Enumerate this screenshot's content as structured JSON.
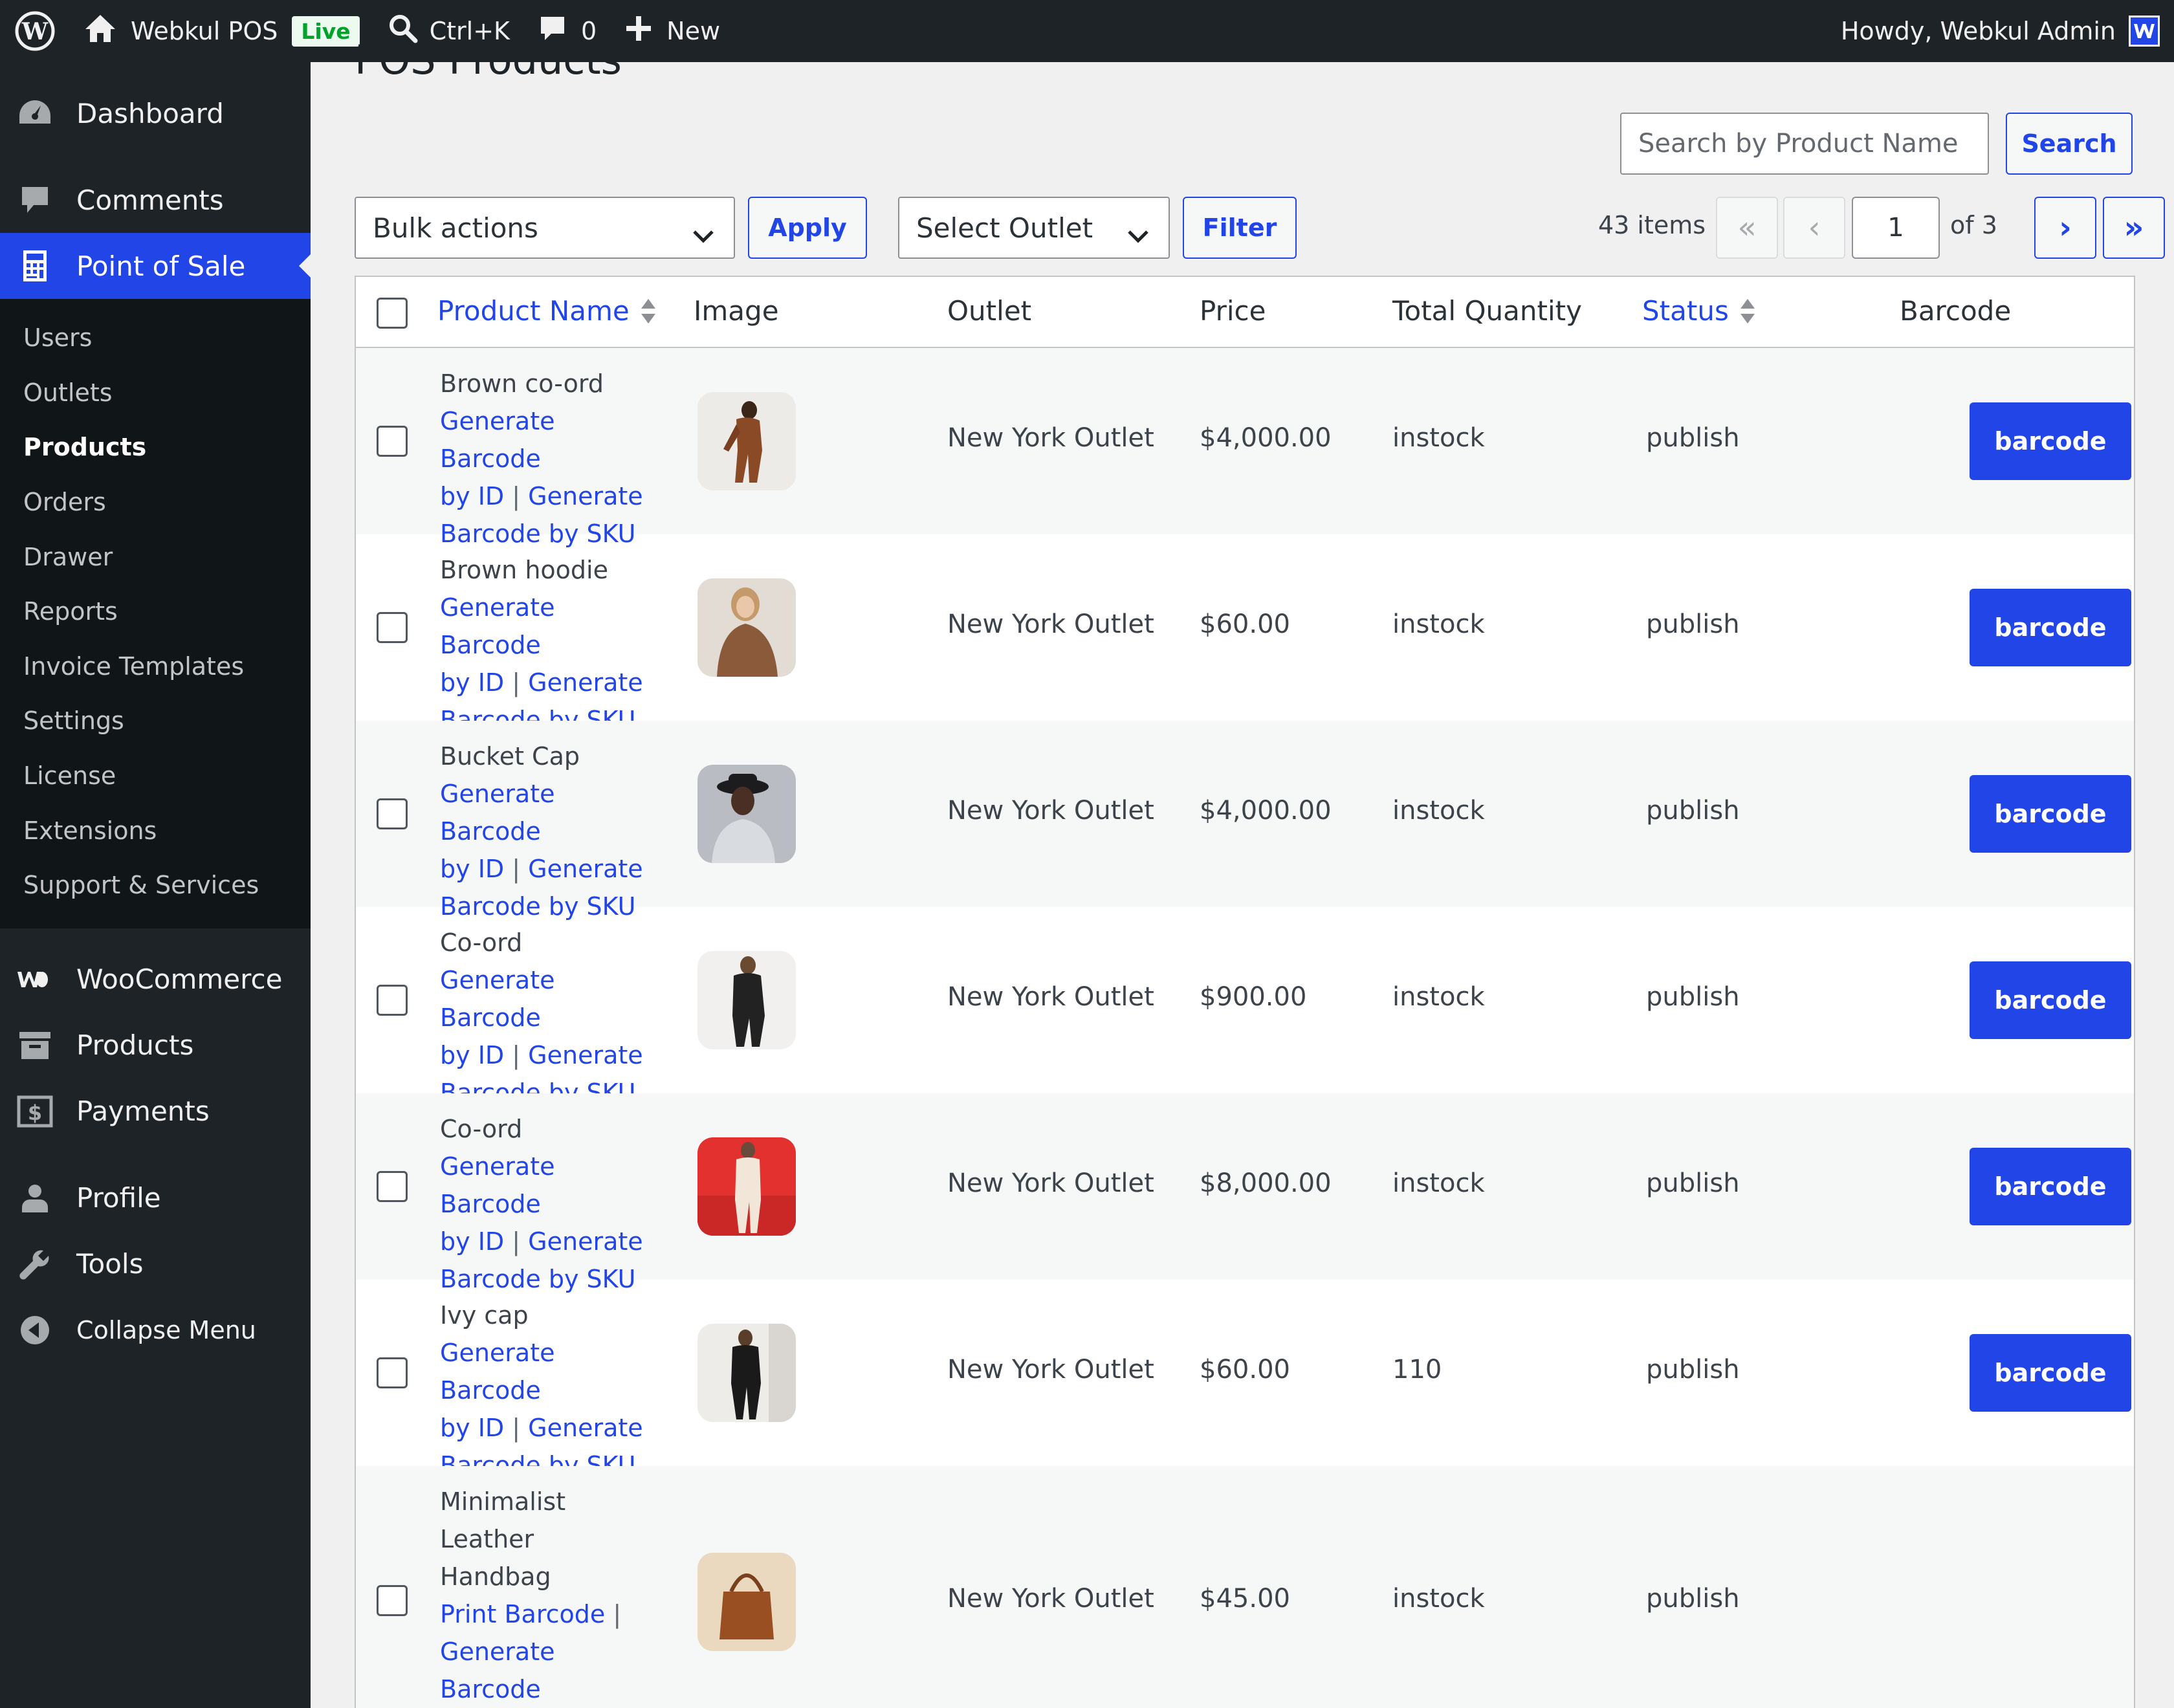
{
  "adminbar": {
    "site_name": "Webkul POS",
    "live_badge": "Live",
    "search_shortcut": "Ctrl+K",
    "comments_count": "0",
    "new_label": "New",
    "howdy": "Howdy, Webkul Admin"
  },
  "sidebar": {
    "dashboard": "Dashboard",
    "comments": "Comments",
    "pos": "Point of Sale",
    "pos_sub": [
      "Users",
      "Outlets",
      "Products",
      "Orders",
      "Drawer",
      "Reports",
      "Invoice Templates",
      "Settings",
      "License",
      "Extensions",
      "Support & Services"
    ],
    "woocommerce": "WooCommerce",
    "products": "Products",
    "payments": "Payments",
    "profile": "Profile",
    "tools": "Tools",
    "collapse": "Collapse Menu"
  },
  "page": {
    "title": "POS Products",
    "search_placeholder": "Search by Product Name",
    "search_button": "Search",
    "bulk_actions": "Bulk actions",
    "apply": "Apply",
    "select_outlet": "Select Outlet",
    "filter": "Filter",
    "items_count": "43 items",
    "first": "«",
    "prev": "‹",
    "current_page": "1",
    "of_pages": "of 3",
    "next": "›",
    "last": "»"
  },
  "table": {
    "headers": {
      "name": "Product Name",
      "image": "Image",
      "outlet": "Outlet",
      "price": "Price",
      "qty": "Total Quantity",
      "status": "Status",
      "barcode": "Barcode"
    },
    "link_generate_id_1": "Generate Barcode",
    "link_generate_id_2": "by ID",
    "link_separator": "|",
    "link_generate_sku_1": "Generate",
    "link_generate_sku_2": "Barcode by SKU",
    "link_print": "Print Barcode",
    "barcode_button": "barcode",
    "rows": [
      {
        "name": "Brown co-ord",
        "outlet": "New York Outlet",
        "price": "$4,000.00",
        "qty": "instock",
        "status": "publish"
      },
      {
        "name": "Brown hoodie",
        "outlet": "New York Outlet",
        "price": "$60.00",
        "qty": "instock",
        "status": "publish"
      },
      {
        "name": "Bucket Cap",
        "outlet": "New York Outlet",
        "price": "$4,000.00",
        "qty": "instock",
        "status": "publish"
      },
      {
        "name": "Co-ord",
        "outlet": "New York Outlet",
        "price": "$900.00",
        "qty": "instock",
        "status": "publish"
      },
      {
        "name": "Co-ord",
        "outlet": "New York Outlet",
        "price": "$8,000.00",
        "qty": "instock",
        "status": "publish"
      },
      {
        "name": "Ivy cap",
        "outlet": "New York Outlet",
        "price": "$60.00",
        "qty": "110",
        "status": "publish"
      },
      {
        "name_line1": "Minimalist Leather",
        "name_line2": "Handbag",
        "outlet": "New York Outlet",
        "price": "$45.00",
        "qty": "instock",
        "status": "publish"
      }
    ]
  },
  "colors": {
    "accent": "#2145e6",
    "adminbar_bg": "#1d2327"
  }
}
